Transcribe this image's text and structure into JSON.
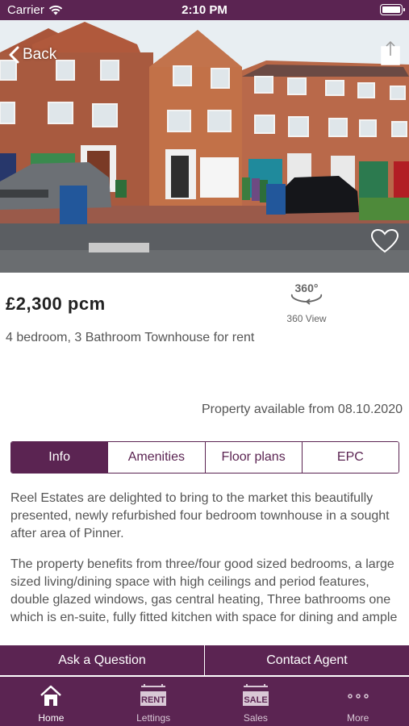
{
  "status": {
    "carrier": "Carrier",
    "time": "2:10 PM"
  },
  "nav": {
    "back_label": "Back"
  },
  "property": {
    "price": "£2,300 pcm",
    "description": "4 bedroom, 3 Bathroom Townhouse for rent",
    "view360_icon_text": "360°",
    "view360_label": "360 View",
    "available": "Property available from 08.10.2020"
  },
  "tabs": [
    {
      "label": "Info",
      "active": true
    },
    {
      "label": "Amenities",
      "active": false
    },
    {
      "label": "Floor plans",
      "active": false
    },
    {
      "label": "EPC",
      "active": false
    }
  ],
  "info": {
    "paragraphs": [
      "Reel Estates are delighted to bring to the market this beautifully presented, newly refurbished four bedroom townhouse in a sought after area of Pinner.",
      "The property benefits from three/four good sized bedrooms, a large sized living/dining space with high ceilings and period features, double glazed windows, gas central heating, Three bathrooms one which is en-suite, fully fitted kitchen with space for dining and ample"
    ]
  },
  "actions": {
    "ask": "Ask a Question",
    "contact": "Contact Agent"
  },
  "tabbar": [
    {
      "label": "Home",
      "icon": "home-icon",
      "badge": "",
      "active": true
    },
    {
      "label": "Lettings",
      "icon": "rent-sign-icon",
      "badge": "RENT",
      "active": false
    },
    {
      "label": "Sales",
      "icon": "sale-sign-icon",
      "badge": "SALE",
      "active": false
    },
    {
      "label": "More",
      "icon": "more-dots-icon",
      "badge": "",
      "active": false
    }
  ],
  "colors": {
    "brand": "#5b2452",
    "brick": "#b5603e",
    "text": "#555555"
  }
}
